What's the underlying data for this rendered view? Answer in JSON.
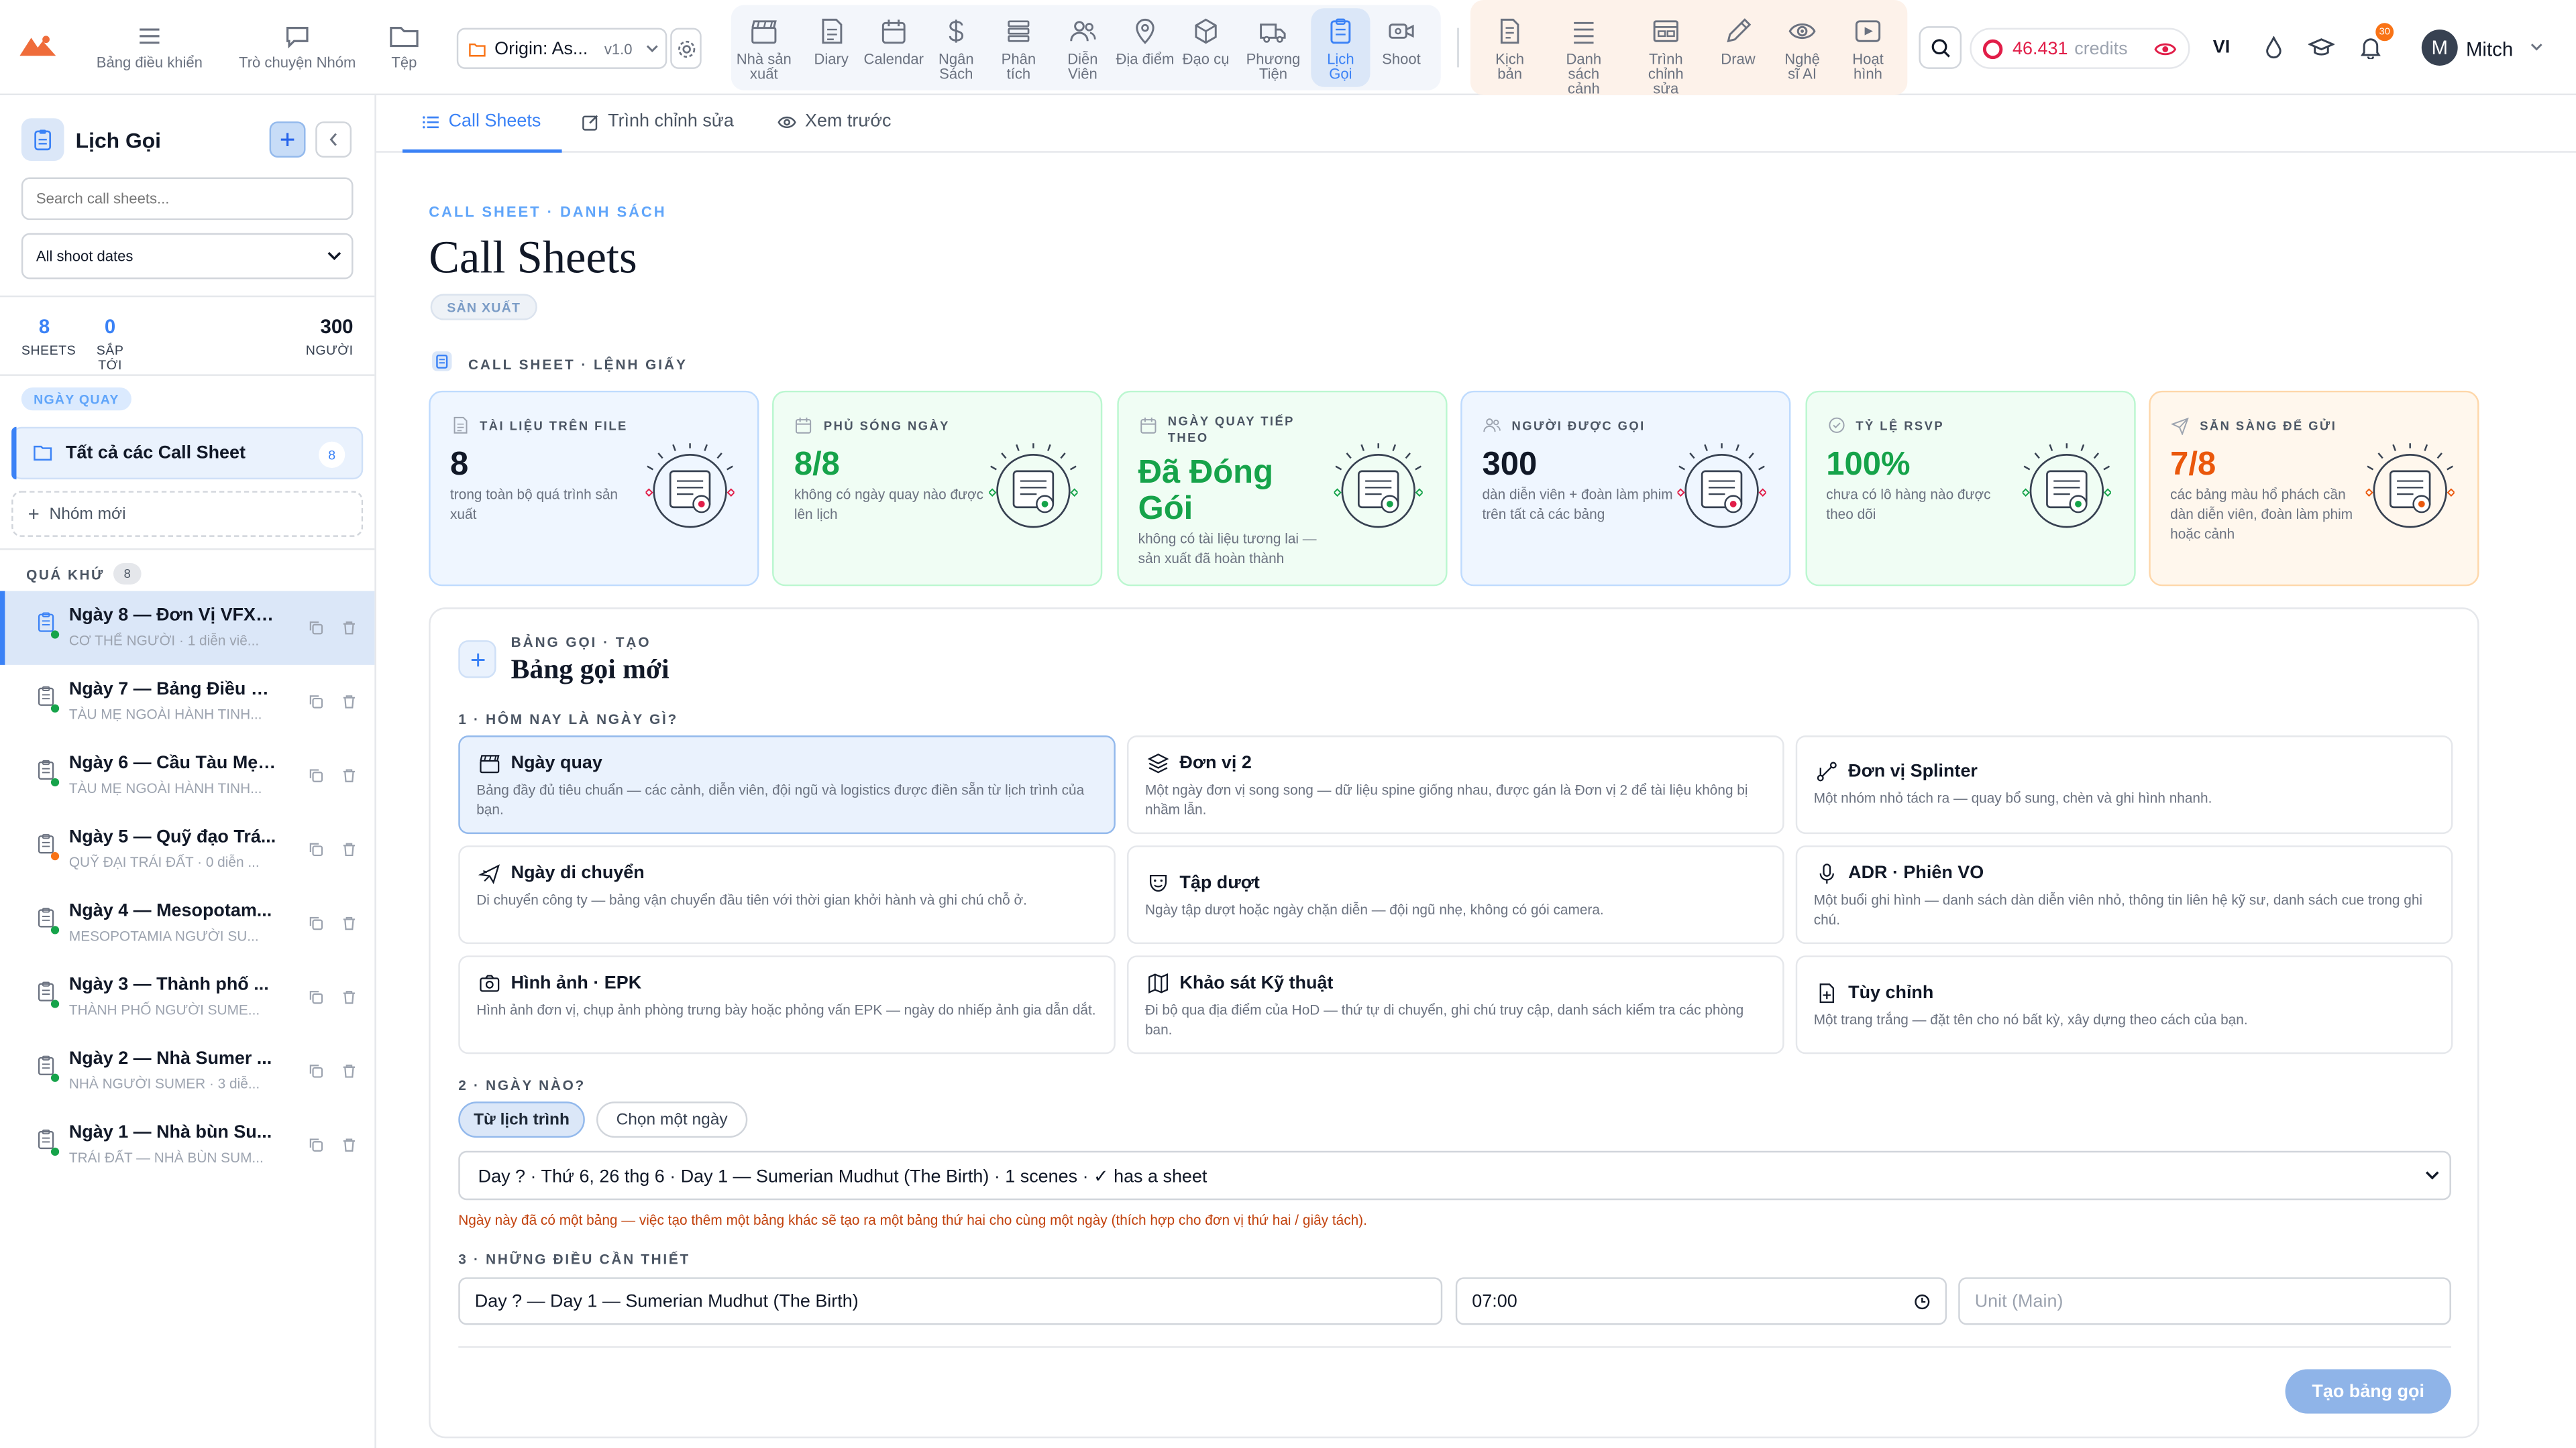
{
  "topbar": {
    "left_nav": [
      {
        "label": "Bảng điều khiển",
        "icon": "hamburger-icon"
      },
      {
        "label": "Trò chuyện Nhóm",
        "icon": "chat-bubble-icon"
      },
      {
        "label": "Tệp",
        "icon": "folder-icon"
      }
    ],
    "project": {
      "name": "Origin: As...",
      "version": "v1.0"
    },
    "nav_tools": [
      {
        "label": "Nhà sản xuất",
        "icon": "clapperboard-icon"
      },
      {
        "label": "Diary",
        "icon": "document-icon"
      },
      {
        "label": "Calendar",
        "icon": "calendar-icon"
      },
      {
        "label": "Ngân Sách",
        "icon": "dollar-icon"
      },
      {
        "label": "Phân tích",
        "icon": "stack-icon"
      },
      {
        "label": "Diễn Viên",
        "icon": "people-icon"
      },
      {
        "label": "Địa điểm",
        "icon": "map-pin-icon"
      },
      {
        "label": "Đạo cụ",
        "icon": "cube-icon"
      },
      {
        "label": "Phương Tiện",
        "icon": "truck-icon"
      },
      {
        "label": "Lịch Gọi",
        "icon": "clipboard-icon"
      },
      {
        "label": "Shoot",
        "icon": "video-camera-icon"
      }
    ],
    "right_tools": [
      {
        "label": "Kịch bản",
        "icon": "script-icon"
      },
      {
        "label": "Danh sách cảnh",
        "icon": "list-icon"
      },
      {
        "label": "Trình chỉnh sửa",
        "icon": "editor-icon"
      },
      {
        "label": "Draw",
        "icon": "pencil-icon"
      },
      {
        "label": "Nghệ sĩ AI",
        "icon": "eye-icon"
      },
      {
        "label": "Hoạt hình",
        "icon": "play-icon"
      }
    ],
    "credits_value": "46.431",
    "credits_label": "credits",
    "language": "VI",
    "notification_count": "30",
    "avatar_letter": "M",
    "username": "Mitch"
  },
  "sidebar": {
    "title": "Lịch Gọi",
    "search_placeholder": "Search call sheets...",
    "date_filter": "All shoot dates",
    "stats": [
      {
        "value": "8",
        "label": "SHEETS"
      },
      {
        "value": "0",
        "label": "SẮP TỚI"
      },
      {
        "value": "300",
        "label": "NGƯỜI"
      }
    ],
    "group_badge": "NGÀY QUAY",
    "all_label": "Tất cả các Call Sheet",
    "all_count": "8",
    "new_group": "Nhóm mới",
    "past_label": "QUÁ KHỨ",
    "past_count": "8",
    "sheets": [
      {
        "title": "Ngày 8 — Đơn Vị VFX: ...",
        "subtitle": "CƠ THỂ NGƯỜI · 1 diễn viê...",
        "dot": "#16a34a"
      },
      {
        "title": "Ngày 7 — Bảng Điều K...",
        "subtitle": "TÀU MẸ NGOÀI HÀNH TINH...",
        "dot": "#16a34a"
      },
      {
        "title": "Ngày 6 — Cầu Tàu Mẹ ...",
        "subtitle": "TÀU MẸ NGOÀI HÀNH TINH...",
        "dot": "#16a34a"
      },
      {
        "title": "Ngày 5 — Quỹ đạo Trá...",
        "subtitle": "QUỸ ĐẠI TRÁI ĐẤT · 0 diễn ...",
        "dot": "#f97316"
      },
      {
        "title": "Ngày 4 — Mesopotam...",
        "subtitle": "MESOPOTAMIA NGƯỜI SU...",
        "dot": "#16a34a"
      },
      {
        "title": "Ngày 3 — Thành phố ...",
        "subtitle": "THÀNH PHỐ NGƯỜI SUME...",
        "dot": "#16a34a"
      },
      {
        "title": "Ngày 2 — Nhà Sumer ...",
        "subtitle": "NHÀ NGƯỜI SUMER · 3 diễ...",
        "dot": "#16a34a"
      },
      {
        "title": "Ngày 1 — Nhà bùn Su...",
        "subtitle": "TRÁI ĐẤT — NHÀ BÙN SUM...",
        "dot": "#16a34a"
      }
    ]
  },
  "tabs": [
    {
      "label": "Call Sheets",
      "icon": "list-icon",
      "active": true
    },
    {
      "label": "Trình chỉnh sửa",
      "icon": "edit-icon",
      "active": false
    },
    {
      "label": "Xem trước",
      "icon": "eye-icon",
      "active": false
    }
  ],
  "main": {
    "eyebrow": "CALL SHEET · DANH SÁCH",
    "title": "Call Sheets",
    "badge": "SẢN XUẤT",
    "cards_heading": "CALL SHEET · LỆNH GIẤY",
    "cards": [
      {
        "label": "TÀI LIỆU TRÊN FILE",
        "value": "8",
        "desc": "trong toàn bộ quá trình sản xuất",
        "bg": "#eff6ff",
        "border": "#bfdbfe",
        "color": "#111827",
        "icon": "document-icon",
        "art": "files-illustration"
      },
      {
        "label": "PHỦ SÓNG NGÀY",
        "value": "8/8",
        "desc": "không có ngày quay nào được lên lịch",
        "bg": "#f0fdf4",
        "border": "#bbf7d0",
        "color": "#16a34a",
        "icon": "calendar-icon",
        "art": "calendar-illustration"
      },
      {
        "label": "NGÀY QUAY TIẾP THEO",
        "value": "Đã Đóng Gói",
        "desc": "không có tài liệu tương lai — sản xuất đã hoàn thành",
        "bg": "#f0fdf4",
        "border": "#bbf7d0",
        "color": "#16a34a",
        "icon": "calendar-icon",
        "art": "clapperboard-illustration"
      },
      {
        "label": "NGƯỜI ĐƯỢC GỌI",
        "value": "300",
        "desc": "dàn diễn viên + đoàn làm phim trên tất cả các bảng",
        "bg": "#eff6ff",
        "border": "#bfdbfe",
        "color": "#111827",
        "icon": "people-icon",
        "art": "checklist-illustration"
      },
      {
        "label": "TỶ LỆ RSVP",
        "value": "100%",
        "desc": "chưa có lô hàng nào được theo dõi",
        "bg": "#f0fdf4",
        "border": "#bbf7d0",
        "color": "#16a34a",
        "icon": "check-circle-icon",
        "art": "clipboard-illustration"
      },
      {
        "label": "SẴN SÀNG ĐỂ GỬI",
        "value": "7/8",
        "desc": "các bảng màu hổ phách cần dàn diễn viên, đoàn làm phim hoặc cảnh",
        "bg": "#fff7ed",
        "border": "#fed7aa",
        "color": "#ea580c",
        "icon": "send-icon",
        "art": "envelope-illustration"
      }
    ],
    "create": {
      "eyebrow": "BẢNG GỌI · TẠO",
      "title": "Bảng gọi mới",
      "q1": "1 · HÔM NAY LÀ NGÀY GÌ?",
      "options": [
        {
          "title": "Ngày quay",
          "desc": "Bảng đầy đủ tiêu chuẩn — các cảnh, diễn viên, đội ngũ và logistics được điền sẵn từ lịch trình của bạn.",
          "icon": "clapperboard-icon",
          "selected": true
        },
        {
          "title": "Đơn vị 2",
          "desc": "Một ngày đơn vị song song — dữ liệu spine giống nhau, được gán là Đơn vị 2 để tài liệu không bị nhầm lẫn.",
          "icon": "layers-icon",
          "selected": false
        },
        {
          "title": "Đơn vị Splinter",
          "desc": "Một nhóm nhỏ tách ra — quay bổ sung, chèn và ghi hình nhanh.",
          "icon": "split-icon",
          "selected": false
        },
        {
          "title": "Ngày di chuyển",
          "desc": "Di chuyển công ty — bảng vận chuyển đầu tiên với thời gian khởi hành và ghi chú chỗ ở.",
          "icon": "plane-icon",
          "selected": false
        },
        {
          "title": "Tập dượt",
          "desc": "Ngày tập dượt hoặc ngày chặn diễn — đội ngũ nhẹ, không có gói camera.",
          "icon": "theater-icon",
          "selected": false
        },
        {
          "title": "ADR · Phiên VO",
          "desc": "Một buổi ghi hình — danh sách dàn diễn viên nhỏ, thông tin liên hệ kỹ sư, danh sách cue trong ghi chú.",
          "icon": "microphone-icon",
          "selected": false
        },
        {
          "title": "Hình ảnh · EPK",
          "desc": "Hình ảnh đơn vị, chụp ảnh phòng trưng bày hoặc phỏng vấn EPK — ngày do nhiếp ảnh gia dẫn dắt.",
          "icon": "camera-icon",
          "selected": false
        },
        {
          "title": "Khảo sát Kỹ thuật",
          "desc": "Đi bộ qua địa điểm của HoD — thứ tự di chuyển, ghi chú truy cập, danh sách kiểm tra các phòng ban.",
          "icon": "map-icon",
          "selected": false
        },
        {
          "title": "Tùy chỉnh",
          "desc": "Một trang trắng — đặt tên cho nó bất kỳ, xây dựng theo cách của bạn.",
          "icon": "file-plus-icon",
          "selected": false
        }
      ],
      "q2": "2 · NGÀY NÀO?",
      "toggle": [
        "Từ lịch trình",
        "Chọn một ngày"
      ],
      "day_select": "Day ? · Thứ 6, 26 thg 6 · Day 1 — Sumerian Mudhut (The Birth) · 1 scenes · ✓ has a sheet",
      "warning": "Ngày này đã có một bảng — việc tạo thêm một bảng khác sẽ tạo ra một bảng thứ hai cho cùng một ngày (thích hợp cho đơn vị thứ hai / giây tách).",
      "q3": "3 · NHỮNG ĐIỀU CẦN THIẾT",
      "name_value": "Day ? — Day 1 — Sumerian Mudhut (The Birth)",
      "time_value": "07:00",
      "unit_placeholder": "Unit (Main)",
      "submit": "Tạo bảng gọi"
    }
  }
}
